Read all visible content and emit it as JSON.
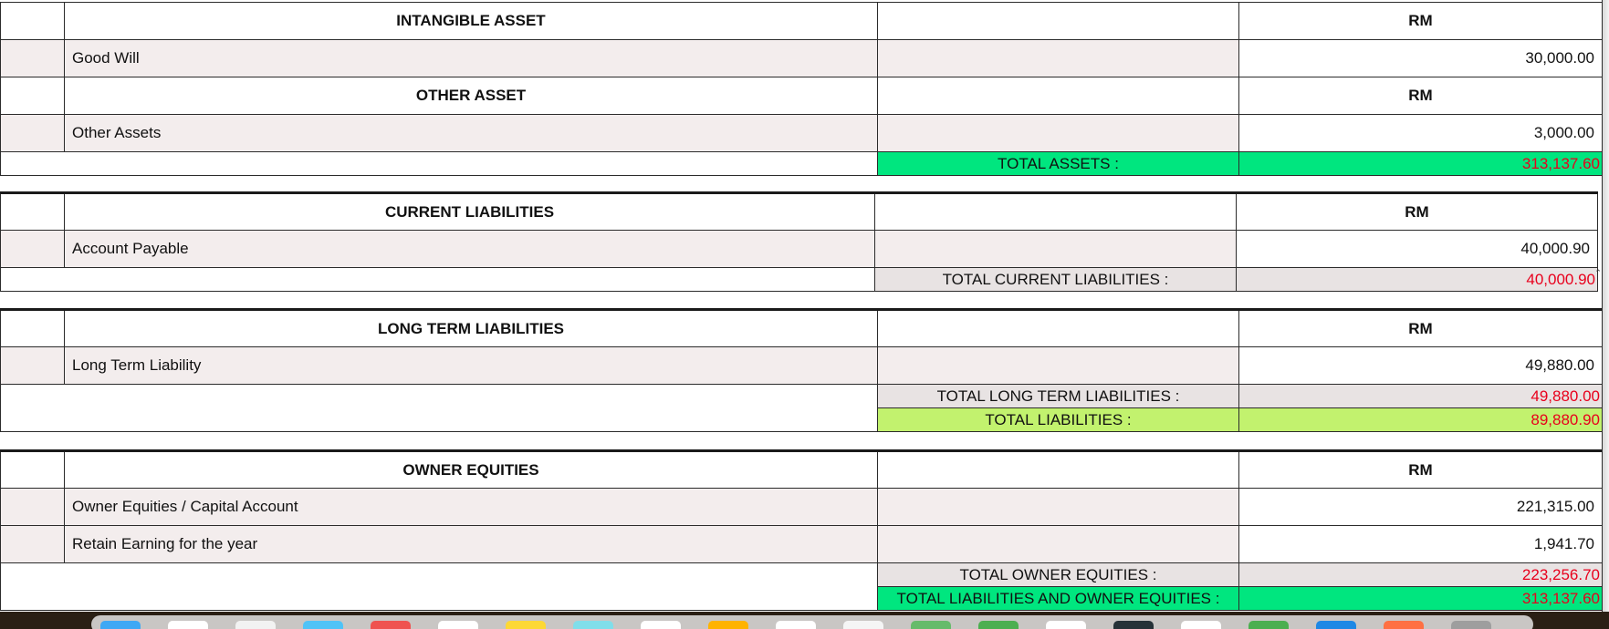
{
  "sections": {
    "intangible": {
      "heading": "INTANGIBLE ASSET",
      "currency": "RM",
      "items": [
        {
          "label": "Good Will",
          "value": "30,000.00"
        }
      ]
    },
    "other": {
      "heading": "OTHER ASSET",
      "currency": "RM",
      "items": [
        {
          "label": "Other Assets",
          "value": "3,000.00"
        }
      ],
      "total_label": "TOTAL ASSETS :",
      "total_value": "313,137.60"
    },
    "current_liabilities": {
      "heading": "CURRENT LIABILITIES",
      "currency": "RM",
      "items": [
        {
          "label": "Account Payable",
          "value": "40,000.90"
        }
      ],
      "total_label": "TOTAL CURRENT LIABILITIES :",
      "total_value": "40,000.90"
    },
    "long_term_liabilities": {
      "heading": "LONG TERM LIABILITIES",
      "currency": "RM",
      "items": [
        {
          "label": "Long Term Liability",
          "value": "49,880.00"
        }
      ],
      "total_label": "TOTAL LONG TERM LIABILITIES :",
      "total_value": "49,880.00",
      "grand_label": "TOTAL LIABILITIES :",
      "grand_value": "89,880.90"
    },
    "owner_equities": {
      "heading": "OWNER EQUITIES",
      "currency": "RM",
      "items": [
        {
          "label": "Owner Equities / Capital Account",
          "value": "221,315.00"
        },
        {
          "label": "Retain Earning for the year",
          "value": "1,941.70"
        }
      ],
      "total_label": "TOTAL OWNER EQUITIES :",
      "total_value": "223,256.70",
      "grand_label": "TOTAL LIABILITIES AND OWNER EQUITIES :",
      "grand_value": "313,137.60"
    }
  },
  "scroll_caret": "ˆ",
  "colors": {
    "total_highlight": "#00e67f",
    "liabilities_highlight": "#c2f26e",
    "subtotal_bg": "#e8e3e3",
    "row_bg": "#f3eded",
    "negative_red": "#e8001c"
  },
  "dock": {
    "icon_colors": [
      "#3ea8f5",
      "#ffffff",
      "#f2f2f2",
      "#4fc3f7",
      "#ef5350",
      "#ffffff",
      "#fdd835",
      "#80deea",
      "#ffffff",
      "#ffb300",
      "#ffffff",
      "#f5f5f5",
      "#66bb6a",
      "#4caf50",
      "#ffffff",
      "#263238",
      "#ffffff",
      "#4caf50",
      "#1e88e5",
      "#ff7043",
      "#9e9e9e"
    ]
  }
}
